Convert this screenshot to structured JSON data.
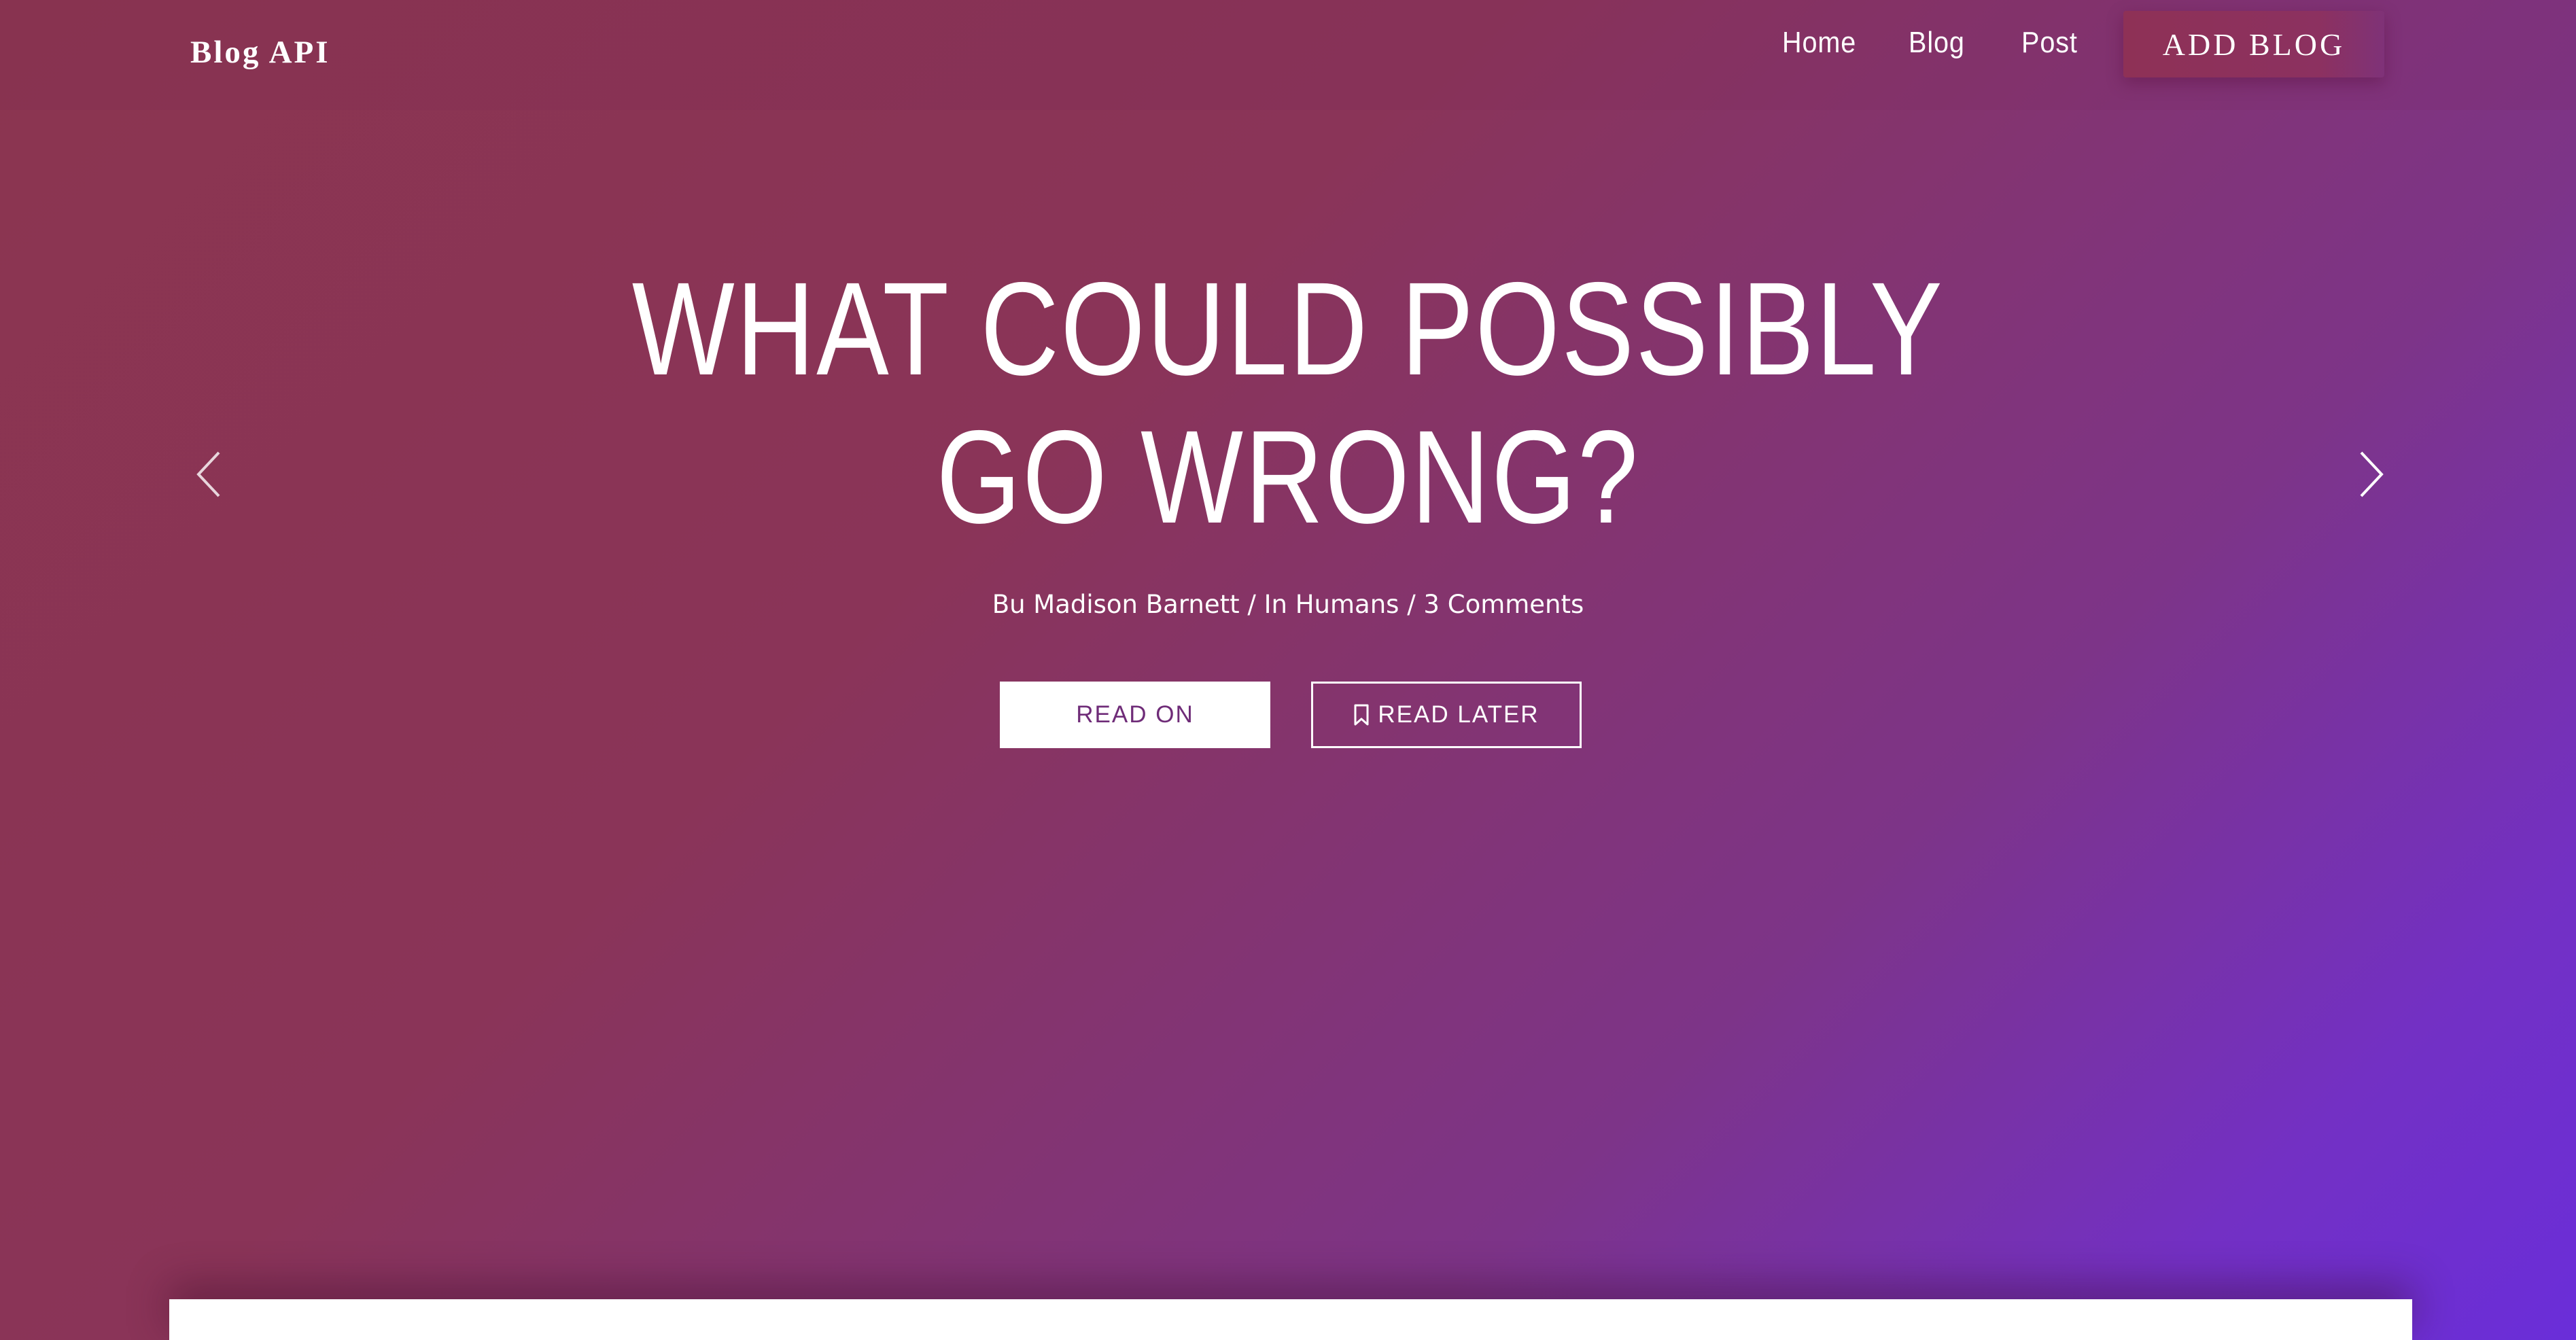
{
  "header": {
    "brand": "Blog API",
    "nav": [
      {
        "label": "Home"
      },
      {
        "label": "Blog"
      },
      {
        "label": "Post"
      }
    ],
    "cta_label": "ADD BLOG"
  },
  "hero": {
    "title": "WHAT COULD POSSIBLY GO WRONG?",
    "meta": "Bu Madison Barnett / In Humans / 3 Comments",
    "primary_button": "READ ON",
    "secondary_button": "READ LATER",
    "prev_icon": "chevron-left-icon",
    "next_icon": "chevron-right-icon",
    "bookmark_icon": "bookmark-icon"
  },
  "colors": {
    "gradient_start": "#8b3550",
    "gradient_end": "#6a2ed9",
    "accent": "#8e3156",
    "button_text": "#6f2c78"
  }
}
